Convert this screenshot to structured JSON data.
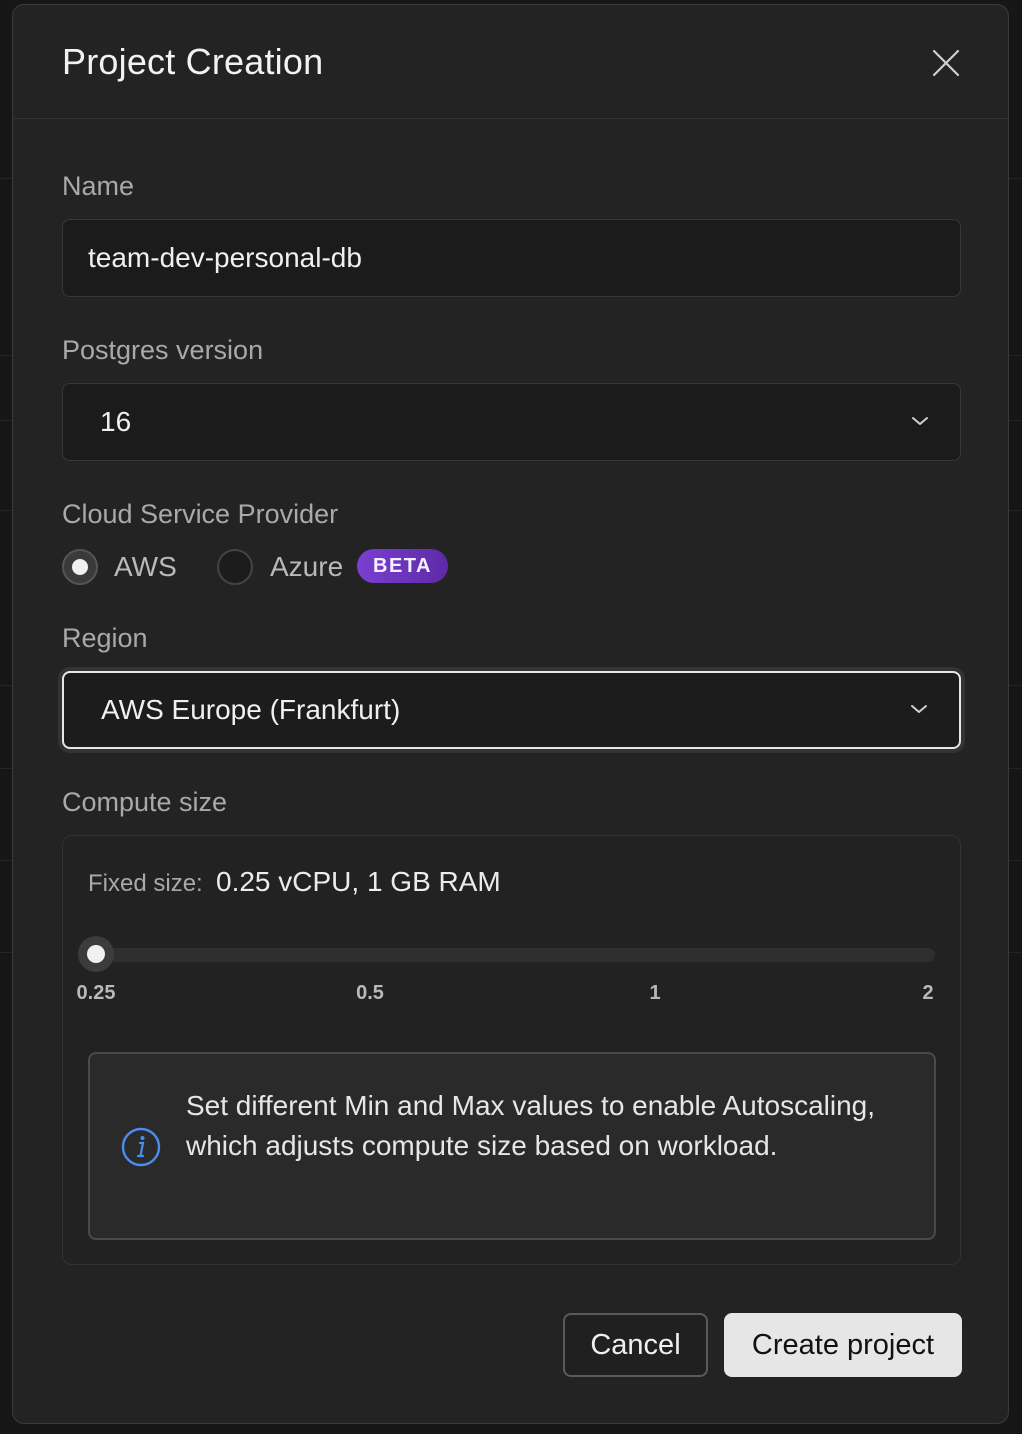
{
  "modal": {
    "title": "Project Creation"
  },
  "form": {
    "name": {
      "label": "Name",
      "value": "team-dev-personal-db"
    },
    "postgres_version": {
      "label": "Postgres version",
      "selected": "16"
    },
    "cloud_provider": {
      "label": "Cloud Service Provider",
      "options": [
        {
          "label": "AWS",
          "checked": true
        },
        {
          "label": "Azure",
          "checked": false,
          "badge": "BETA"
        }
      ]
    },
    "region": {
      "label": "Region",
      "selected": "AWS Europe (Frankfurt)"
    },
    "compute": {
      "label": "Compute size",
      "fixed_label": "Fixed size:",
      "fixed_value": "0.25 vCPU, 1 GB RAM",
      "slider_value": 0.25,
      "ticks": [
        "0.25",
        "0.5",
        "1",
        "2"
      ],
      "info_text": "Set different Min and Max values to enable Autoscaling, which adjusts compute size based on workload."
    }
  },
  "actions": {
    "cancel": "Cancel",
    "create": "Create project"
  },
  "colors": {
    "badge": "#7a3fd0",
    "info_icon": "#4a8df0"
  }
}
